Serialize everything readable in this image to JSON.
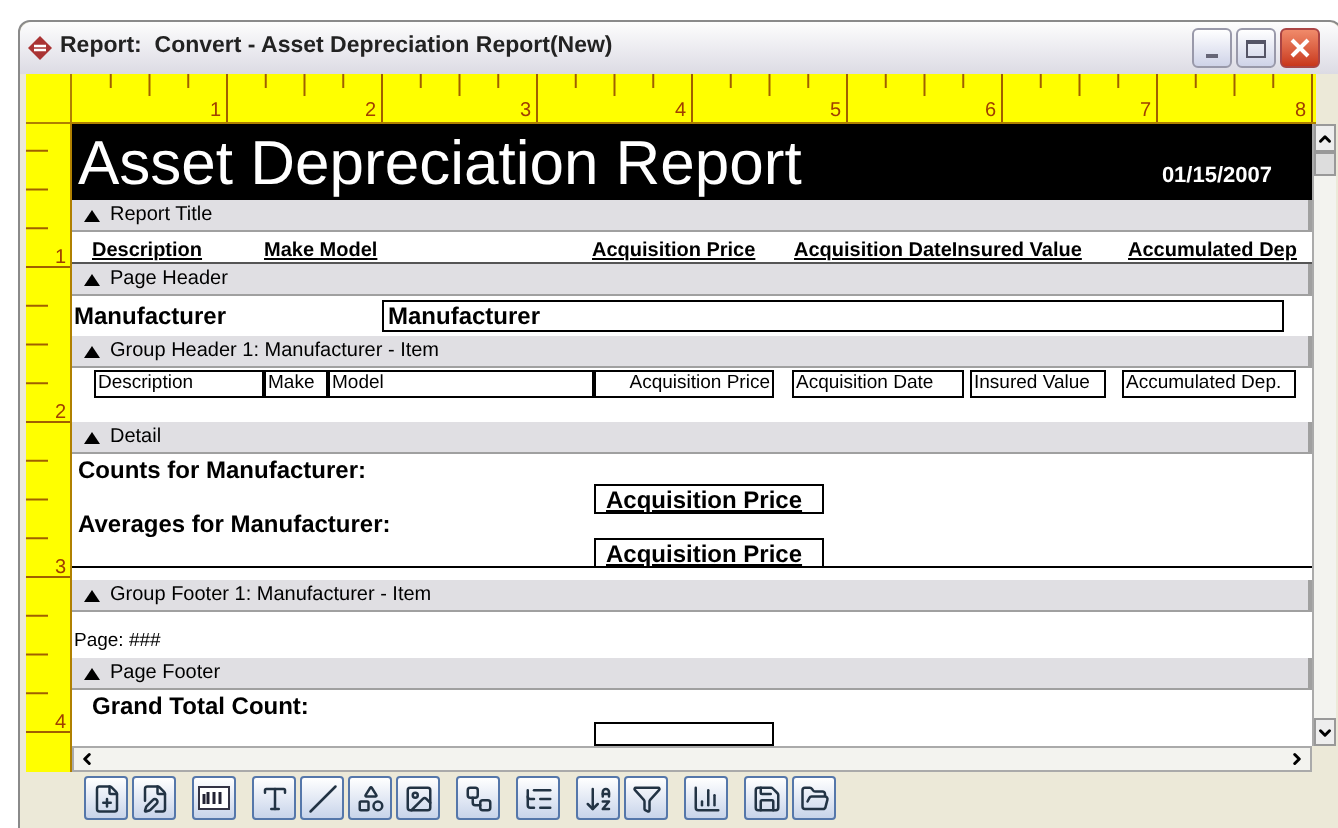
{
  "window": {
    "title": "Report:  Convert - Asset Depreciation Report(New)"
  },
  "top_ruler": [
    "1",
    "2",
    "3",
    "4",
    "5",
    "6",
    "7",
    "8"
  ],
  "left_ruler": [
    "1",
    "2",
    "3",
    "4"
  ],
  "banner": {
    "title": "Asset Depreciation Report",
    "date": "01/15/2007"
  },
  "bands": [
    {
      "kind": "headings",
      "label": "Report Title",
      "items": [
        "Description",
        "Make Model",
        "Acquisition Price",
        "Acquisition DateInsured Value",
        "Accumulated Dep"
      ]
    },
    {
      "kind": "page_header",
      "label": "Page Header",
      "text": "Manufacturer",
      "field": "Manufacturer"
    },
    {
      "kind": "fields",
      "label": "Group Header 1:  Manufacturer - Item",
      "items": [
        "Description",
        "Make",
        "Model",
        "Acquisition Price",
        "Acquisition Date",
        "Insured Value",
        "Accumulated Dep."
      ]
    },
    {
      "kind": "detail",
      "label": "Detail",
      "rows": [
        {
          "text": "Counts for Manufacturer:",
          "field": "Acquisition Price"
        },
        {
          "text": "Averages for Manufacturer:",
          "field": "Acquisition Price"
        }
      ]
    },
    {
      "kind": "footer",
      "label": "Group Footer 1:  Manufacturer - Item",
      "text": "Page: ###"
    },
    {
      "kind": "total",
      "label": "Page Footer",
      "text": "Grand Total Count:"
    }
  ]
}
